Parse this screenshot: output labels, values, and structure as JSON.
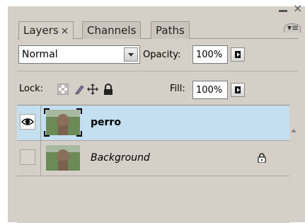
{
  "tabs": [
    {
      "label": "Layers",
      "close": "×",
      "active": true
    },
    {
      "label": "Channels",
      "active": false
    },
    {
      "label": "Paths",
      "active": false
    }
  ],
  "window": {
    "minimize": "–",
    "close": "×"
  },
  "blend_mode": "Normal",
  "opacity": {
    "label": "Opacity:",
    "value": "100%"
  },
  "lock": {
    "label": "Lock:"
  },
  "fill": {
    "label": "Fill:",
    "value": "100%"
  },
  "layers": [
    {
      "name": "perro",
      "visible": true,
      "selected": true,
      "locked": false
    },
    {
      "name": "Background",
      "visible": false,
      "selected": false,
      "locked": true
    }
  ],
  "colors": {
    "panel_bg": "#d4d0c8",
    "selected_row": "#c3dff0"
  }
}
